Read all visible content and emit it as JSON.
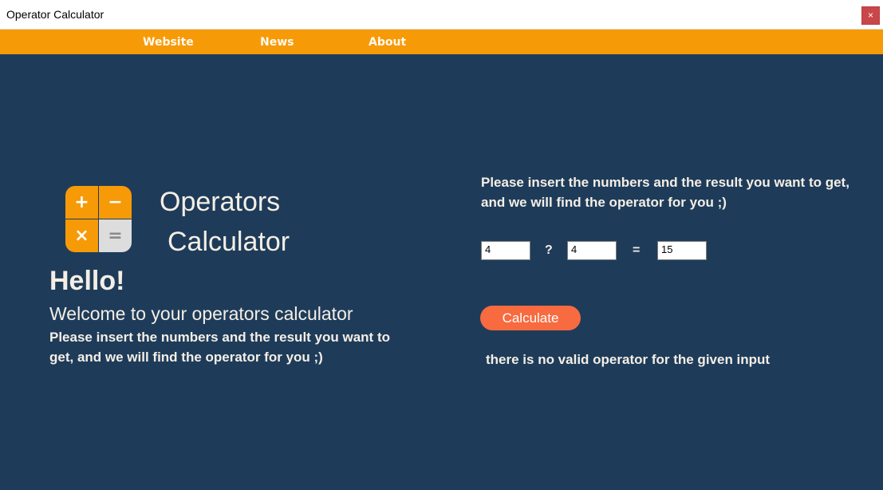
{
  "window": {
    "title": "Operator Calculator",
    "close_label": "×"
  },
  "nav": {
    "items": [
      {
        "label": "Website"
      },
      {
        "label": "News"
      },
      {
        "label": "About"
      }
    ]
  },
  "logo": {
    "icon": "calculator-icon",
    "symbols": [
      "+",
      "−",
      "×",
      "="
    ],
    "colors": {
      "orange": "#f79a08",
      "grey": "#dddddd"
    }
  },
  "left": {
    "app_name_line1": "Operators",
    "app_name_line2": "Calculator",
    "hello": "Hello!",
    "welcome": "Welcome to your operators calculator",
    "description": "Please insert the numbers and the result you want to get, and we will find the operator for you ;)"
  },
  "right": {
    "description": "Please insert the numbers and the result you want to get, and we will find the operator for you ;)",
    "operand1": "4",
    "operator_symbol": "?",
    "operand2": "4",
    "equals_symbol": "=",
    "result_value": "15",
    "calculate_label": "Calculate",
    "result_message": "there is no valid operator for the given input"
  },
  "colors": {
    "background": "#1e3c5a",
    "navbar": "#f79a08",
    "button": "#f86a3f",
    "close": "#c9474a",
    "text": "#f5eee5"
  }
}
